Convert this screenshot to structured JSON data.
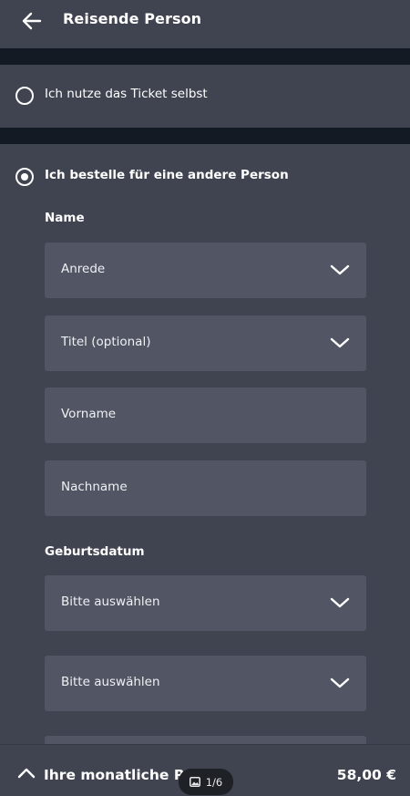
{
  "header": {
    "title": "Reisende Person",
    "back_icon": "arrow-left-icon"
  },
  "options": {
    "self": {
      "label": "Ich nutze das Ticket selbst",
      "selected": false
    },
    "other": {
      "label": "Ich bestelle für eine andere Person",
      "selected": true
    }
  },
  "name_section": {
    "label": "Name",
    "salutation": "Anrede",
    "title": "Titel (optional)",
    "firstname": "Vorname",
    "lastname": "Nachname"
  },
  "birth_section": {
    "label": "Geburtsdatum",
    "select1": "Bitte auswählen",
    "select2": "Bitte auswählen"
  },
  "footer": {
    "label": "Ihre monatliche Rate",
    "price": "58,00 €"
  },
  "pager": {
    "text": "1/6",
    "icon": "image-icon"
  },
  "colors": {
    "background": "#3f4450",
    "field": "#525664",
    "separator": "#141a24"
  }
}
